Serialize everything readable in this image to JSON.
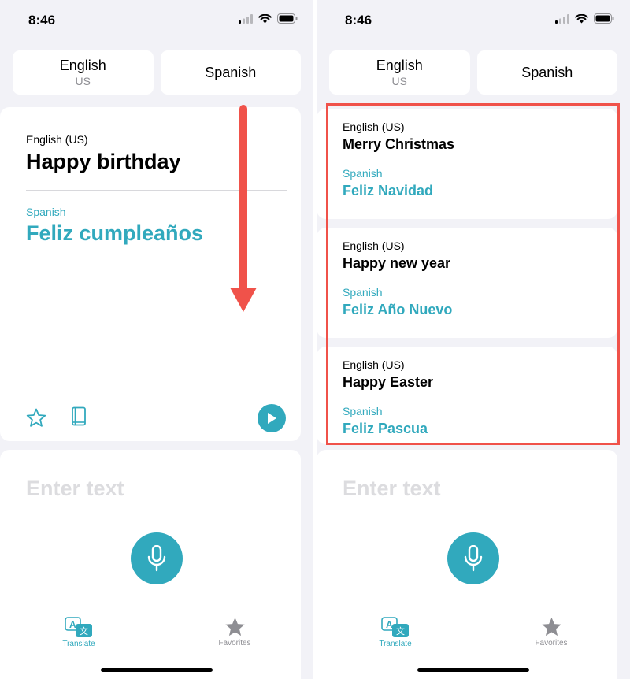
{
  "colors": {
    "accent": "#31a9bd",
    "highlight": "#f0524a",
    "arrow": "#f0524a",
    "background": "#f2f2f7"
  },
  "left": {
    "status": {
      "time": "8:46"
    },
    "languages": {
      "source": "English",
      "source_sub": "US",
      "target": "Spanish"
    },
    "translation": {
      "source_label": "English (US)",
      "source_text": "Happy birthday",
      "target_label": "Spanish",
      "target_text": "Feliz cumpleaños"
    },
    "input": {
      "placeholder": "Enter text"
    },
    "tabs": [
      {
        "label": "Translate",
        "icon": "translate-icon"
      },
      {
        "label": "Favorites",
        "icon": "star-icon"
      }
    ]
  },
  "right": {
    "status": {
      "time": "8:46"
    },
    "languages": {
      "source": "English",
      "source_sub": "US",
      "target": "Spanish"
    },
    "favorites": [
      {
        "source_label": "English (US)",
        "source_text": "Merry Christmas",
        "target_label": "Spanish",
        "target_text": "Feliz Navidad"
      },
      {
        "source_label": "English (US)",
        "source_text": "Happy new year",
        "target_label": "Spanish",
        "target_text": "Feliz Año Nuevo"
      },
      {
        "source_label": "English (US)",
        "source_text": "Happy Easter",
        "target_label": "Spanish",
        "target_text": "Feliz Pascua"
      }
    ],
    "input": {
      "placeholder": "Enter text"
    },
    "tabs": [
      {
        "label": "Translate",
        "icon": "translate-icon"
      },
      {
        "label": "Favorites",
        "icon": "star-icon"
      }
    ]
  }
}
